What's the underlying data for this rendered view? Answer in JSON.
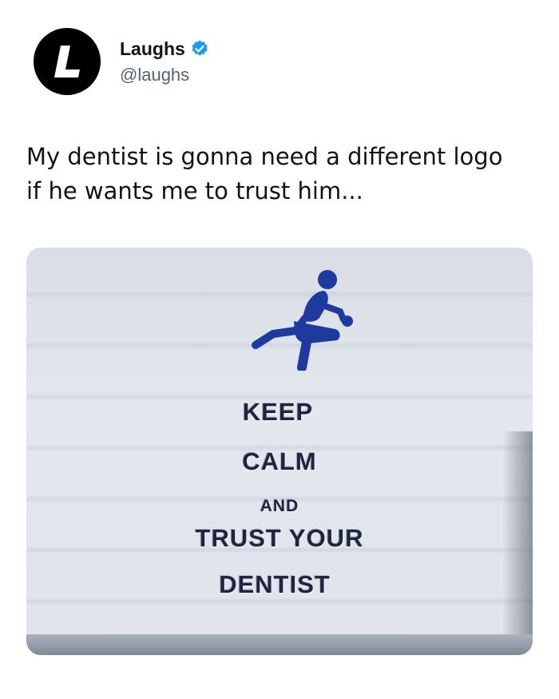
{
  "author": {
    "display_name": "Laughs",
    "handle": "@laughs",
    "avatar_letter": "L",
    "verified": true,
    "verified_color": "#1d9bf0"
  },
  "tweet": {
    "text_line1": "My dentist is gonna need a different logo",
    "text_line2": "if he wants me to trust him..."
  },
  "media": {
    "icon": "dentist-chair-icon",
    "logo_color": "#1f3a9e",
    "sign_lines": {
      "line1": "KEEP",
      "line2": "CALM",
      "line3": "AND",
      "line4": "TRUST YOUR",
      "line5": "DENTIST"
    }
  },
  "colors": {
    "text": "#0f1419",
    "secondary": "#536471"
  }
}
